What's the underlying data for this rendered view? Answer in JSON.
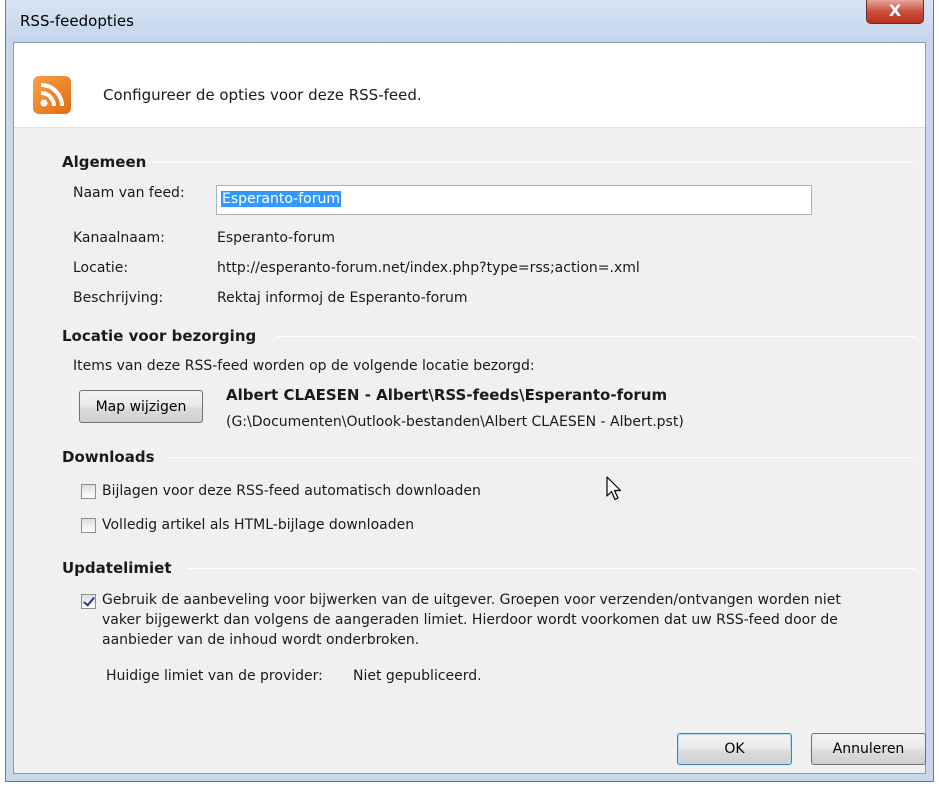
{
  "window": {
    "title": "RSS-feedopties",
    "close_glyph": "X"
  },
  "header": {
    "icon": "rss-feed-icon",
    "text": "Configureer de opties voor deze RSS-feed."
  },
  "general": {
    "title": "Algemeen",
    "feed_name_label": "Naam van feed:",
    "feed_name_value": "Esperanto-forum",
    "channel_label": "Kanaalnaam:",
    "channel_value": "Esperanto-forum",
    "location_label": "Locatie:",
    "location_value": "http://esperanto-forum.net/index.php?type=rss;action=.xml",
    "description_label": "Beschrijving:",
    "description_value": "Rektaj informoj de Esperanto-forum"
  },
  "delivery": {
    "title": "Locatie voor bezorging",
    "info": "Items van deze RSS-feed worden op de volgende locatie bezorgd:",
    "change_button": "Map wijzigen",
    "folder_path": "Albert CLAESEN - Albert\\RSS-feeds\\Esperanto-forum",
    "file_path": "(G:\\Documenten\\Outlook-bestanden\\Albert CLAESEN - Albert.pst)"
  },
  "downloads": {
    "title": "Downloads",
    "attachments_label": "Bijlagen voor deze RSS-feed automatisch downloaden",
    "attachments_checked": false,
    "full_article_label": "Volledig artikel als HTML-bijlage downloaden",
    "full_article_checked": false
  },
  "update_limit": {
    "title": "Updatelimiet",
    "use_recommendation_label_1": "Gebruik de aanbeveling voor bijwerken van de uitgever. Groepen voor verzenden/ontvangen worden niet",
    "use_recommendation_label_2": "vaker bijgewerkt dan volgens de aangeraden limiet. Hierdoor wordt voorkomen dat uw RSS-feed door de",
    "use_recommendation_label_3": "aanbieder van de inhoud wordt onderbroken.",
    "use_recommendation_checked": true,
    "current_limit_label": "Huidige limiet van de provider:",
    "current_limit_value": "Niet gepubliceerd."
  },
  "buttons": {
    "ok": "OK",
    "cancel": "Annuleren"
  }
}
